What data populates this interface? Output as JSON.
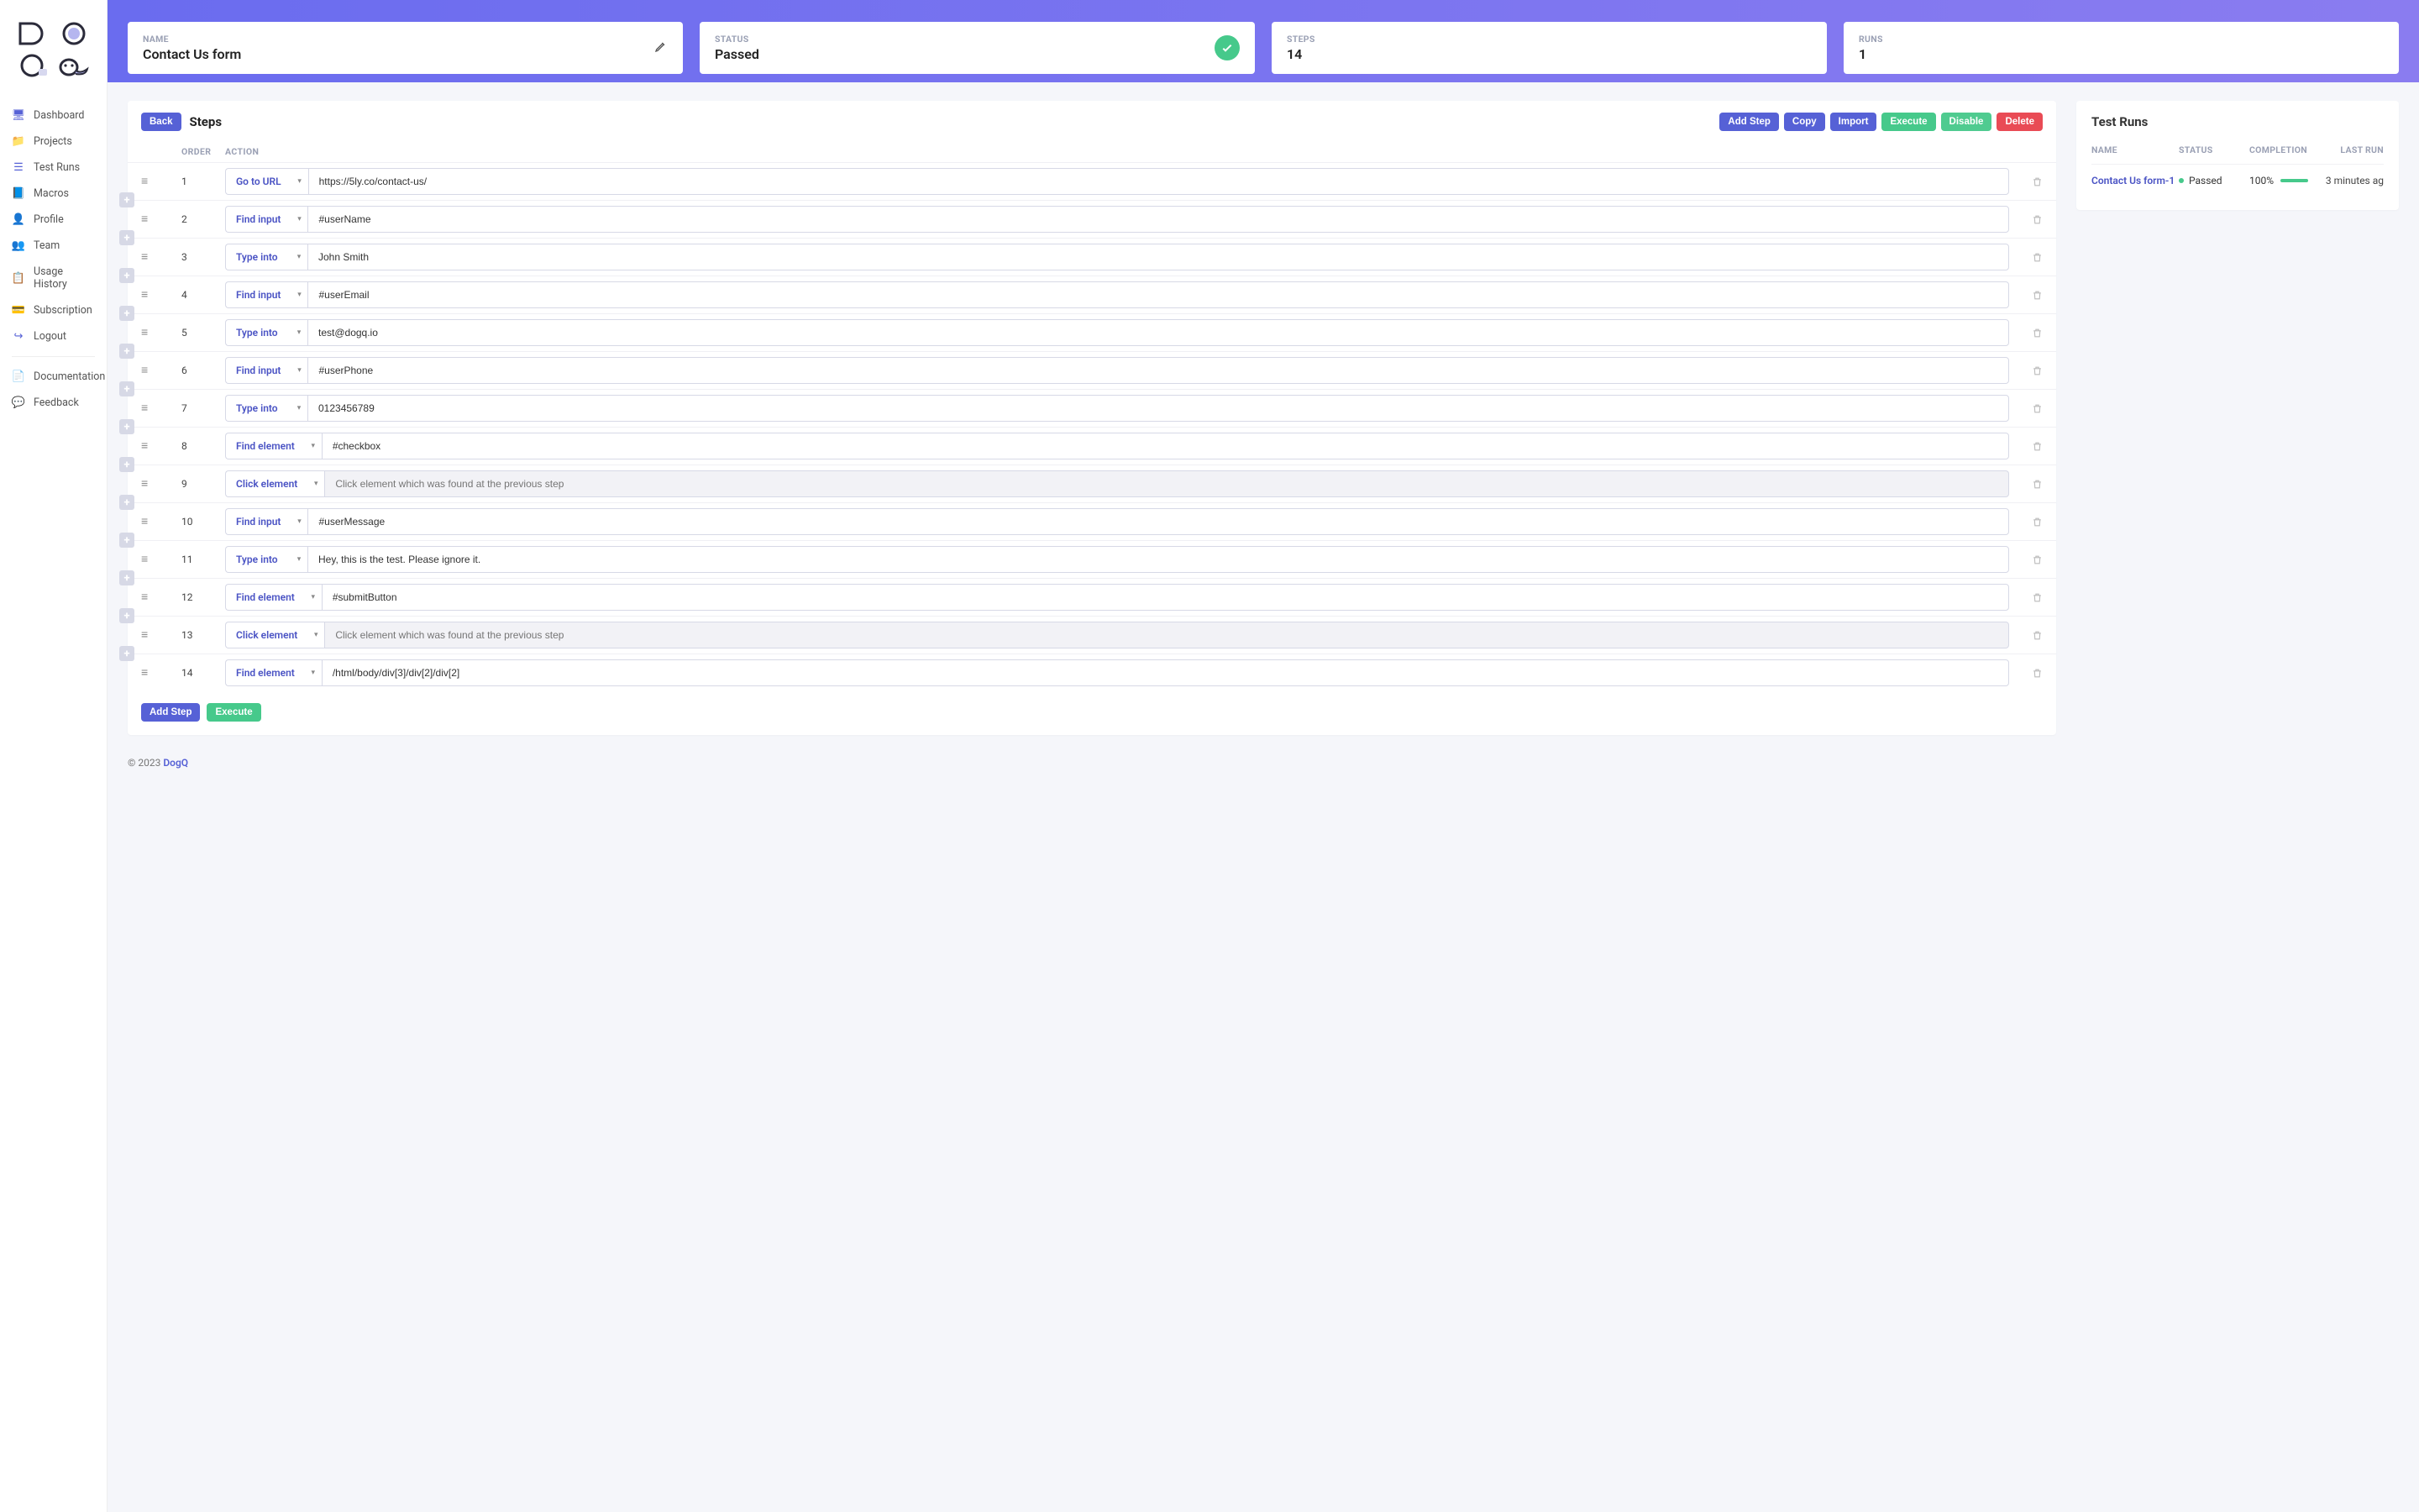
{
  "sidebar": {
    "items": [
      {
        "label": "Dashboard",
        "icon": "monitor-icon"
      },
      {
        "label": "Projects",
        "icon": "folder-icon"
      },
      {
        "label": "Test Runs",
        "icon": "list-icon"
      },
      {
        "label": "Macros",
        "icon": "book-icon"
      },
      {
        "label": "Profile",
        "icon": "user-icon"
      },
      {
        "label": "Team",
        "icon": "users-icon"
      },
      {
        "label": "Usage History",
        "icon": "clipboard-icon"
      },
      {
        "label": "Subscription",
        "icon": "card-icon"
      },
      {
        "label": "Logout",
        "icon": "logout-icon"
      }
    ],
    "secondary": [
      {
        "label": "Documentation",
        "icon": "doc-icon"
      },
      {
        "label": "Feedback",
        "icon": "chat-icon"
      }
    ]
  },
  "banner": {
    "name_label": "NAME",
    "name_value": "Contact Us form",
    "status_label": "STATUS",
    "status_value": "Passed",
    "steps_label": "STEPS",
    "steps_value": "14",
    "runs_label": "RUNS",
    "runs_value": "1"
  },
  "steps_panel": {
    "back_label": "Back",
    "title": "Steps",
    "buttons": {
      "add_step": "Add Step",
      "copy": "Copy",
      "import": "Import",
      "execute": "Execute",
      "disable": "Disable",
      "delete": "Delete"
    },
    "columns": {
      "order": "ORDER",
      "action": "ACTION"
    },
    "footer": {
      "add_step": "Add Step",
      "execute": "Execute"
    },
    "click_placeholder": "Click element which was found at the previous step",
    "rows": [
      {
        "order": "1",
        "action": "Go to URL",
        "value": "https://5ly.co/contact-us/",
        "readonly": false
      },
      {
        "order": "2",
        "action": "Find input",
        "value": "#userName",
        "readonly": false
      },
      {
        "order": "3",
        "action": "Type into",
        "value": "John Smith",
        "readonly": false
      },
      {
        "order": "4",
        "action": "Find input",
        "value": "#userEmail",
        "readonly": false
      },
      {
        "order": "5",
        "action": "Type into",
        "value": "test@dogq.io",
        "readonly": false
      },
      {
        "order": "6",
        "action": "Find input",
        "value": "#userPhone",
        "readonly": false
      },
      {
        "order": "7",
        "action": "Type into",
        "value": "0123456789",
        "readonly": false
      },
      {
        "order": "8",
        "action": "Find element",
        "value": "#checkbox",
        "readonly": false
      },
      {
        "order": "9",
        "action": "Click element",
        "value": "",
        "readonly": true
      },
      {
        "order": "10",
        "action": "Find input",
        "value": "#userMessage",
        "readonly": false
      },
      {
        "order": "11",
        "action": "Type into",
        "value": "Hey, this is the test. Please ignore it.",
        "readonly": false
      },
      {
        "order": "12",
        "action": "Find element",
        "value": "#submitButton",
        "readonly": false
      },
      {
        "order": "13",
        "action": "Click element",
        "value": "",
        "readonly": true
      },
      {
        "order": "14",
        "action": "Find element",
        "value": "/html/body/div[3]/div[2]/div[2]",
        "readonly": false
      }
    ]
  },
  "runs_panel": {
    "title": "Test Runs",
    "columns": {
      "name": "NAME",
      "status": "STATUS",
      "completion": "COMPLETION",
      "last": "LAST RUN"
    },
    "rows": [
      {
        "name": "Contact Us form-1",
        "status": "Passed",
        "completion": "100%",
        "last": "3 minutes ag"
      }
    ]
  },
  "footer": {
    "copyright": "© 2023 ",
    "brand": "DogQ"
  }
}
